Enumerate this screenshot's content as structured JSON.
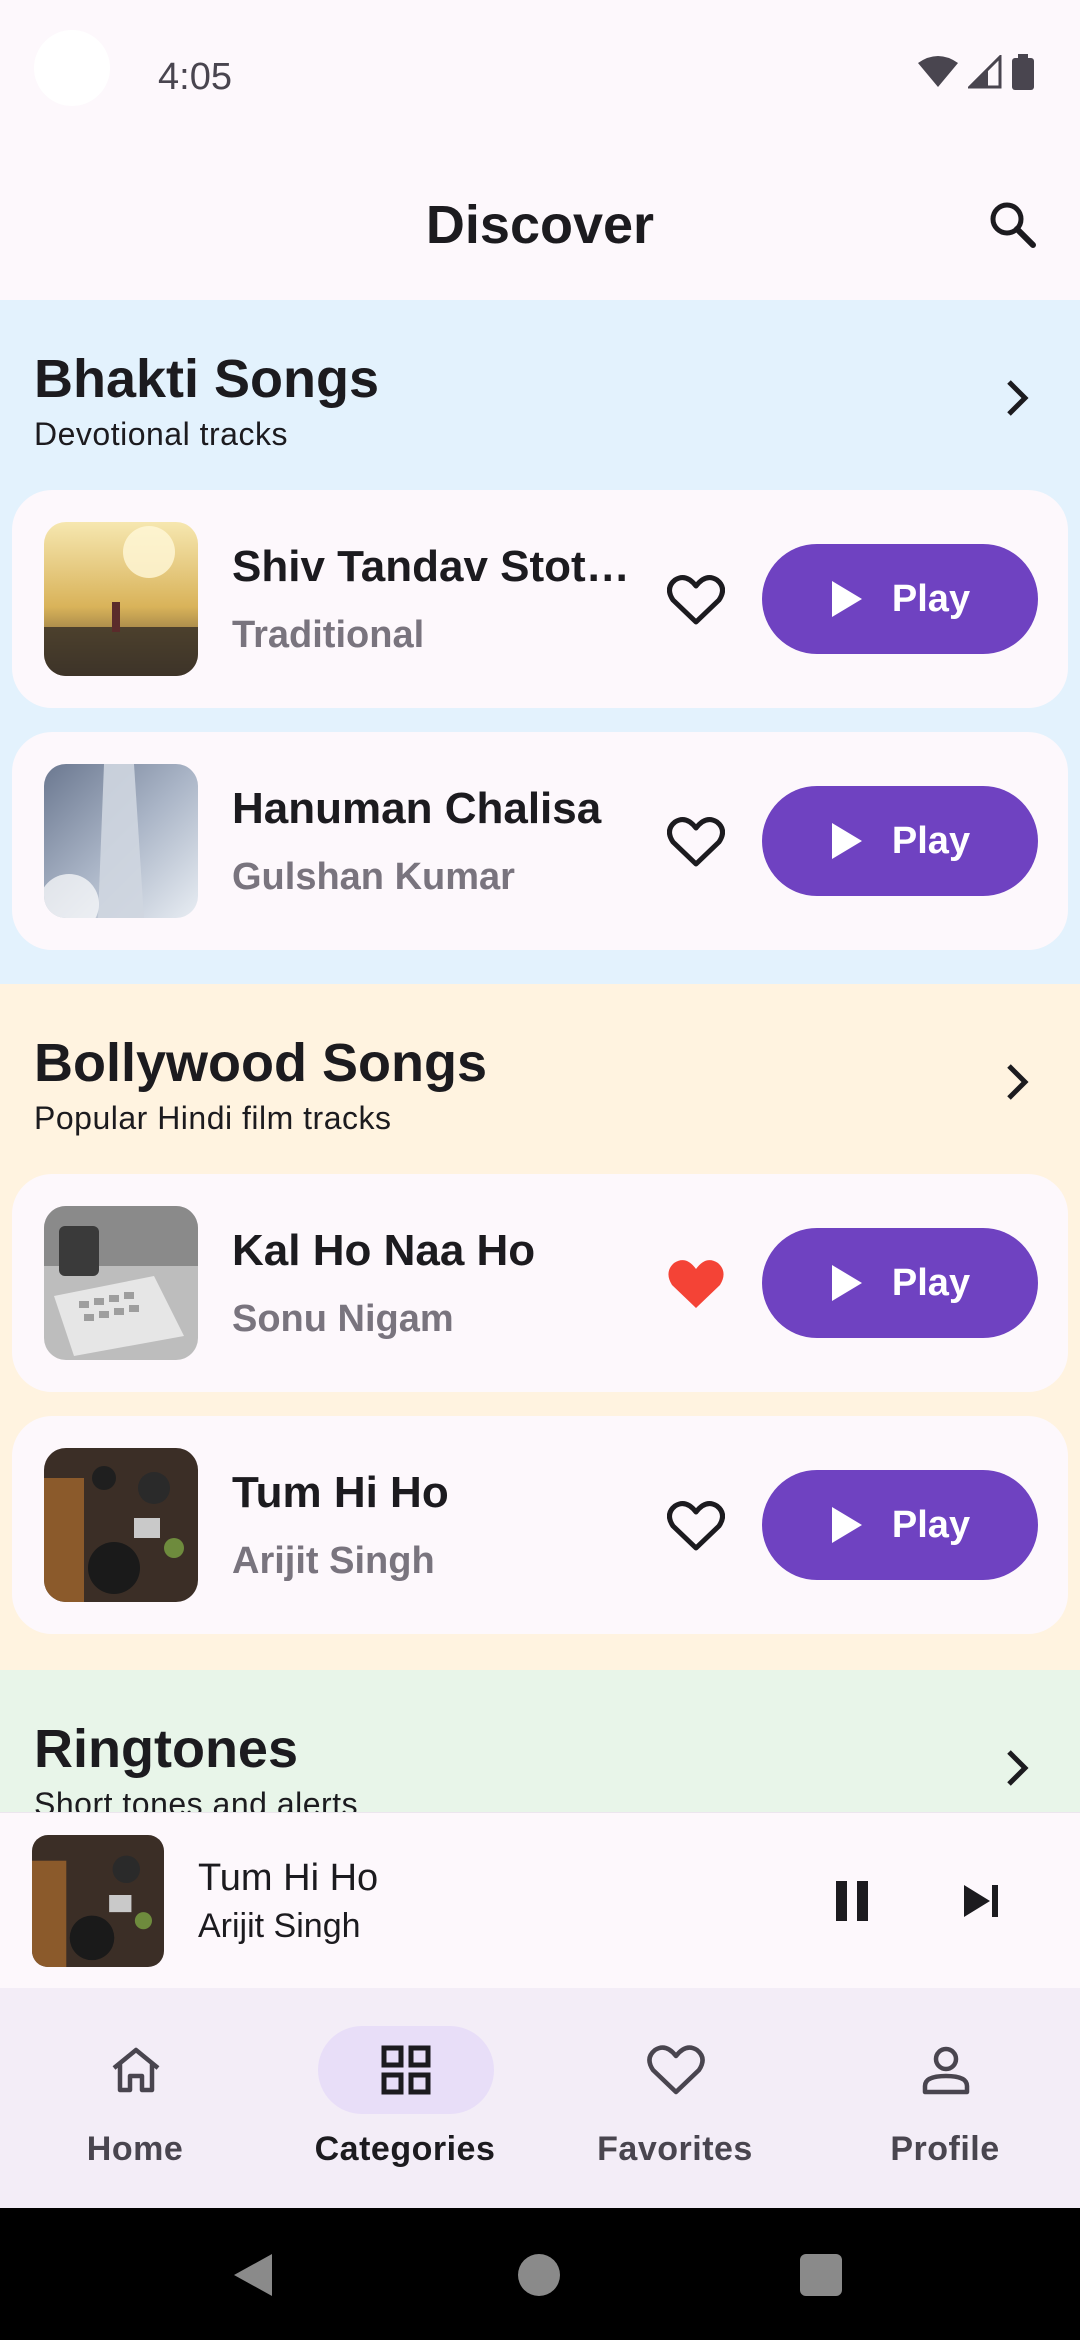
{
  "status_bar": {
    "time": "4:05"
  },
  "app_bar": {
    "title": "Discover",
    "search_icon": "search-icon"
  },
  "colors": {
    "bhakti_bg": "#e3f2fd",
    "bollywood_bg": "#fff3e0",
    "ringtones_bg": "#e8f5e9",
    "accent": "#6f42c1",
    "favorite_active": "#f44336"
  },
  "sections": [
    {
      "title": "Bhakti Songs",
      "subtitle": "Devotional tracks",
      "songs": [
        {
          "title": "Shiv Tandav Stotr...",
          "artist": "Traditional",
          "favorite": false,
          "play_label": "Play"
        },
        {
          "title": "Hanuman Chalisa",
          "artist": "Gulshan Kumar",
          "favorite": false,
          "play_label": "Play"
        }
      ]
    },
    {
      "title": "Bollywood Songs",
      "subtitle": "Popular Hindi film tracks",
      "songs": [
        {
          "title": "Kal Ho Naa Ho",
          "artist": "Sonu Nigam",
          "favorite": true,
          "play_label": "Play"
        },
        {
          "title": "Tum Hi Ho",
          "artist": "Arijit Singh",
          "favorite": false,
          "play_label": "Play"
        }
      ]
    },
    {
      "title": "Ringtones",
      "subtitle": "Short tones and alerts",
      "songs": []
    }
  ],
  "mini_player": {
    "title": "Tum Hi Ho",
    "artist": "Arijit Singh"
  },
  "bottom_nav": {
    "items": [
      {
        "label": "Home",
        "icon": "home-icon",
        "active": false
      },
      {
        "label": "Categories",
        "icon": "grid-icon",
        "active": true
      },
      {
        "label": "Favorites",
        "icon": "heart-icon",
        "active": false
      },
      {
        "label": "Profile",
        "icon": "person-icon",
        "active": false
      }
    ]
  }
}
